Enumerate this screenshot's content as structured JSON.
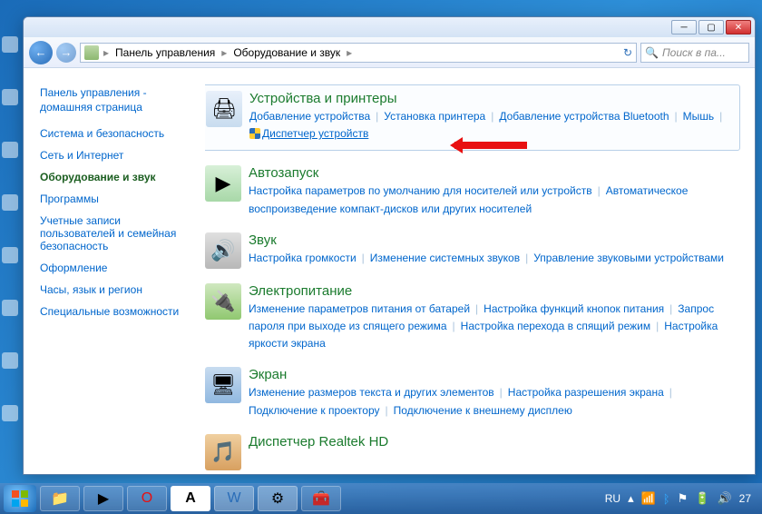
{
  "breadcrumb": {
    "root": "Панель управления",
    "current": "Оборудование и звук"
  },
  "search": {
    "placeholder": "Поиск в па..."
  },
  "sidebar": {
    "home_line1": "Панель управления -",
    "home_line2": "домашняя страница",
    "items": [
      {
        "label": "Система и безопасность"
      },
      {
        "label": "Сеть и Интернет"
      },
      {
        "label": "Оборудование и звук",
        "active": true
      },
      {
        "label": "Программы"
      },
      {
        "label": "Учетные записи пользователей и семейная безопасность"
      },
      {
        "label": "Оформление"
      },
      {
        "label": "Часы, язык и регион"
      },
      {
        "label": "Специальные возможности"
      }
    ]
  },
  "categories": [
    {
      "title": "Устройства и принтеры",
      "links": [
        "Добавление устройства",
        "Установка принтера",
        "Добавление устройства Bluetooth",
        "Мышь",
        "Диспетчер устройств"
      ],
      "highlight": true,
      "shield_index": 4
    },
    {
      "title": "Автозапуск",
      "links": [
        "Настройка параметров по умолчанию для носителей или устройств",
        "Автоматическое воспроизведение компакт-дисков или других носителей"
      ]
    },
    {
      "title": "Звук",
      "links": [
        "Настройка громкости",
        "Изменение системных звуков",
        "Управление звуковыми устройствами"
      ]
    },
    {
      "title": "Электропитание",
      "links": [
        "Изменение параметров питания от батарей",
        "Настройка функций кнопок питания",
        "Запрос пароля при выходе из спящего режима",
        "Настройка перехода в спящий режим",
        "Настройка яркости экрана"
      ]
    },
    {
      "title": "Экран",
      "links": [
        "Изменение размеров текста и других элементов",
        "Настройка разрешения экрана",
        "Подключение к проектору",
        "Подключение к внешнему дисплею"
      ]
    },
    {
      "title": "Диспетчер Realtek HD",
      "links": []
    }
  ],
  "tray": {
    "lang": "RU",
    "clock": "27"
  }
}
